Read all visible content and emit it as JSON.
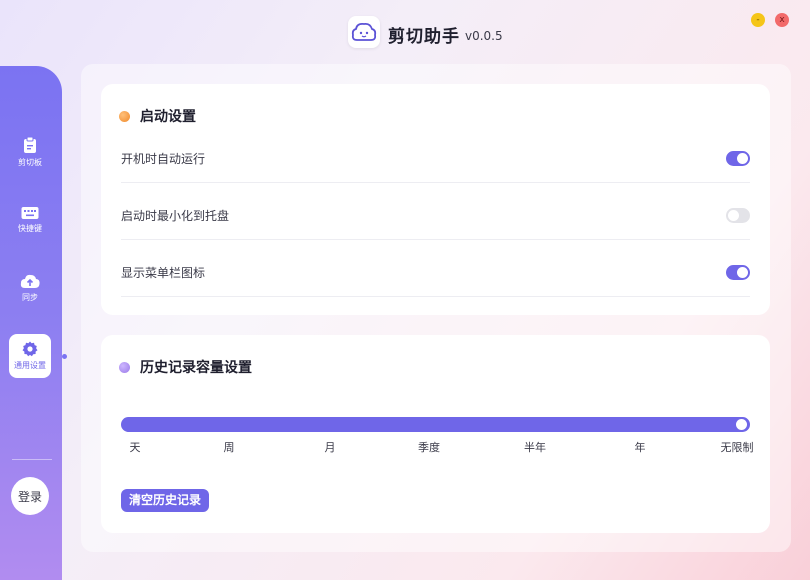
{
  "app": {
    "title": "剪切助手",
    "version": "v0.0.5",
    "logo_icon": "cloud-face-icon"
  },
  "window": {
    "minimize": "-",
    "close": "x"
  },
  "sidebar": {
    "items": [
      {
        "label": "剪切板",
        "icon": "clipboard-icon",
        "active": false
      },
      {
        "label": "快捷键",
        "icon": "keyboard-icon",
        "active": false
      },
      {
        "label": "同步",
        "icon": "cloud-upload-icon",
        "active": false
      },
      {
        "label": "通用设置",
        "icon": "gear-icon",
        "active": true
      }
    ],
    "login": "登录"
  },
  "startup": {
    "title": "启动设置",
    "accent": "#f39a3c",
    "rows": [
      {
        "label": "开机时自动运行",
        "on": true
      },
      {
        "label": "启动时最小化到托盘",
        "on": false
      },
      {
        "label": "显示菜单栏图标",
        "on": true
      }
    ]
  },
  "history": {
    "title": "历史记录容量设置",
    "accent": "#a78bf0",
    "options": [
      "天",
      "周",
      "月",
      "季度",
      "半年",
      "年",
      "无限制"
    ],
    "selected": "无限制",
    "clear_button": "清空历史记录"
  },
  "colors": {
    "primary": "#6f66e8",
    "sidebar_top": "#7b73f2",
    "sidebar_bottom": "#b18cf0"
  }
}
